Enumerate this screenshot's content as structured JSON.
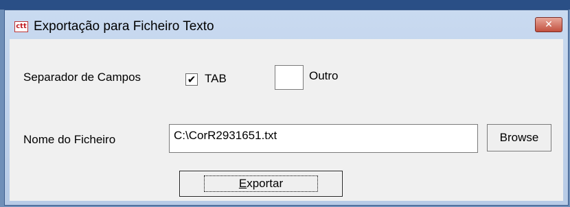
{
  "window": {
    "title": "Exportação para Ficheiro Texto",
    "icon_text": "ctt",
    "close_glyph": "✕"
  },
  "form": {
    "separator_label": "Separador de Campos",
    "tab_label": "TAB",
    "tab_checked": true,
    "check_glyph": "✔",
    "other_label": "Outro",
    "other_value": "",
    "filename_label": "Nome do Ficheiro",
    "filename_value": "C:\\CorR2931651.txt",
    "browse_label": "Browse",
    "export_label_first": "E",
    "export_label_rest": "xportar"
  },
  "icons": [
    "app-icon",
    "close-icon",
    "check-icon"
  ]
}
